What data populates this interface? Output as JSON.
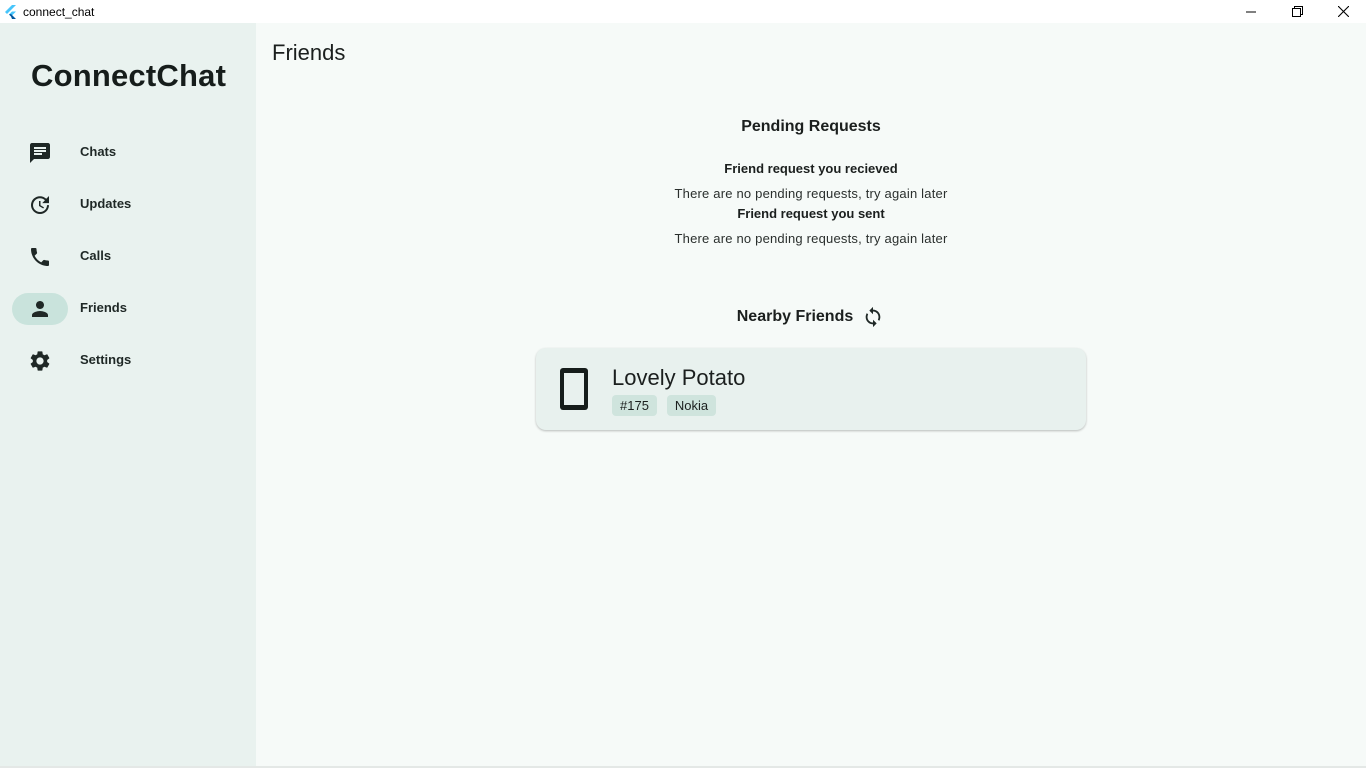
{
  "window": {
    "title": "connect_chat"
  },
  "sidebar": {
    "brand": "ConnectChat",
    "items": [
      {
        "label": "Chats",
        "icon": "chat-icon",
        "active": false
      },
      {
        "label": "Updates",
        "icon": "updates-icon",
        "active": false
      },
      {
        "label": "Calls",
        "icon": "phone-icon",
        "active": false
      },
      {
        "label": "Friends",
        "icon": "person-icon",
        "active": true
      },
      {
        "label": "Settings",
        "icon": "gear-icon",
        "active": false
      }
    ]
  },
  "main": {
    "page_title": "Friends",
    "pending": {
      "title": "Pending Requests",
      "received_title": "Friend request you recieved",
      "received_empty": "There are no pending requests, try again later",
      "sent_title": "Friend request you sent",
      "sent_empty": "There are no pending requests, try again later"
    },
    "nearby": {
      "title": "Nearby Friends",
      "refresh_icon": "refresh-icon",
      "friends": [
        {
          "name": "Lovely Potato",
          "tags": [
            "#175",
            "Nokia"
          ],
          "icon": "smartphone-icon"
        }
      ]
    }
  },
  "colors": {
    "sidebar_bg": "#e9f2ef",
    "main_bg": "#f6faf8",
    "active_pill": "#c9e3dc",
    "card_bg": "#e8f1ee",
    "chip_bg": "#cfe4dd"
  }
}
